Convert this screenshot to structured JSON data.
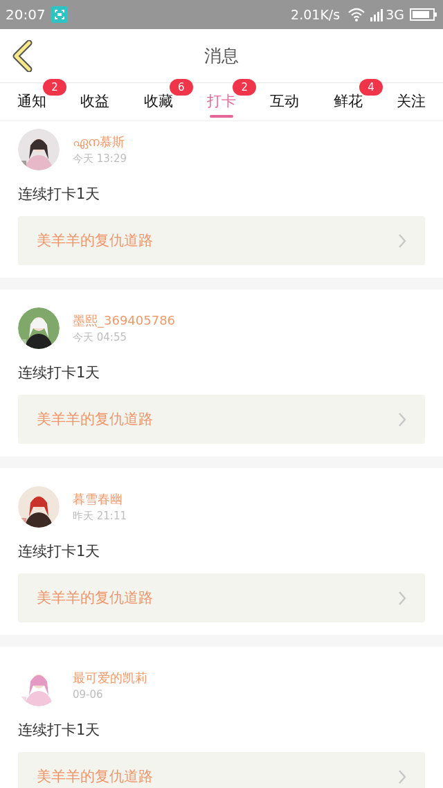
{
  "status_bar": {
    "time": "20:07",
    "speed": "2.01K/s",
    "network": "3G"
  },
  "header": {
    "title": "消息"
  },
  "tabs": [
    {
      "label": "通知",
      "badge": "2",
      "selected": false
    },
    {
      "label": "收益",
      "selected": false
    },
    {
      "label": "收藏",
      "badge": "6",
      "selected": false
    },
    {
      "label": "打卡",
      "badge": "2",
      "selected": true
    },
    {
      "label": "互动",
      "selected": false
    },
    {
      "label": "鲜花",
      "badge": "4",
      "selected": false
    },
    {
      "label": "关注",
      "selected": false
    }
  ],
  "messages": [
    {
      "user": "ഏന慕斯",
      "time": "今天 13:29",
      "text": "连续打卡1天",
      "link": "美羊羊的复仇道路"
    },
    {
      "user": "墨熙_369405786",
      "time": "今天 04:55",
      "text": "连续打卡1天",
      "link": "美羊羊的复仇道路"
    },
    {
      "user": "暮雪春幽",
      "time": "昨天 21:11",
      "text": "连续打卡1天",
      "link": "美羊羊的复仇道路"
    },
    {
      "user": "最可爱的凯莉",
      "time": "09-06",
      "text": "连续打卡1天",
      "link": "美羊羊的复仇道路"
    }
  ]
}
